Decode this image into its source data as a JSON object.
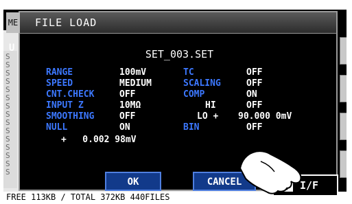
{
  "dialog": {
    "tab_label": "ME",
    "title": "FILE LOAD",
    "filename": "SET_003.SET",
    "left_column": [
      {
        "label": "RANGE",
        "value": "100mV"
      },
      {
        "label": "SPEED",
        "value": "MEDIUM"
      },
      {
        "label": "CNT.CHECK",
        "value": "OFF"
      },
      {
        "label": "INPUT Z",
        "value": "10MΩ"
      },
      {
        "label": "SMOOTHING",
        "value": "OFF"
      },
      {
        "label": "NULL",
        "value": "ON"
      }
    ],
    "null_value": "+   0.002 98mV",
    "right_column": [
      {
        "label": "TC",
        "value": "OFF"
      },
      {
        "label": "SCALING",
        "value": "OFF"
      },
      {
        "label": "COMP",
        "value": "ON"
      },
      {
        "label": "HI",
        "value": "OFF"
      },
      {
        "label": "LO +",
        "value": "90.000 0mV"
      },
      {
        "label": "BIN",
        "value": "OFF"
      }
    ],
    "buttons": {
      "ok_label": "OK",
      "cancel_label": "CANCEL"
    },
    "if_checkbox": {
      "label": "I/F",
      "checked": true
    }
  },
  "background": {
    "u_label": "U",
    "footer": "FREE 113KB / TOTAL 372KB 440FILES",
    "letters": [
      "S",
      "S",
      "S",
      "S",
      "S",
      "S",
      "S",
      "S",
      "S",
      "S",
      "S",
      "S",
      "S",
      "S",
      "S"
    ]
  },
  "colors": {
    "label_blue": "#3c78ff",
    "button_blue": "#123a8a",
    "button_border": "#4f7fe0"
  },
  "icons": [
    "hand-pointer-icon",
    "check-icon"
  ]
}
